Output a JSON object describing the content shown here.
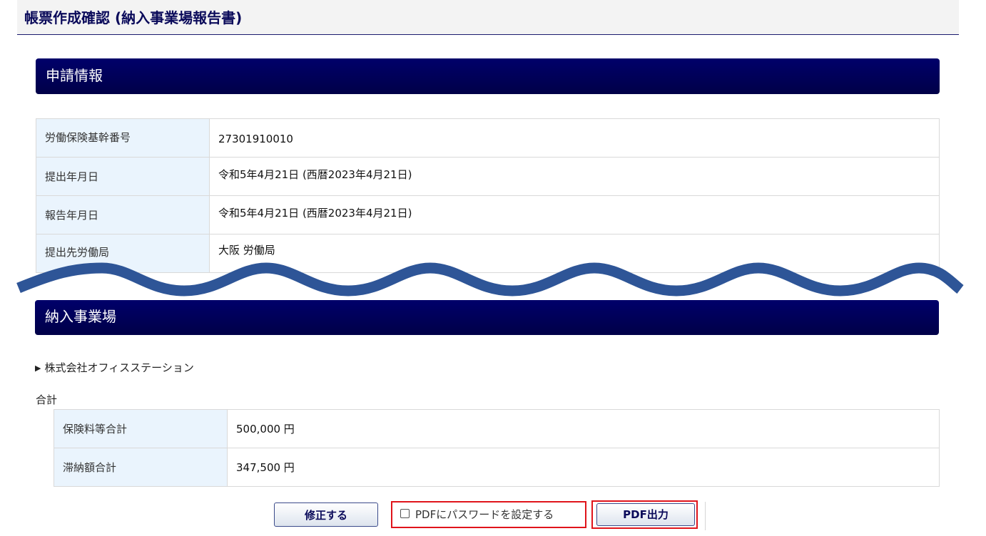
{
  "header": {
    "title": "帳票作成確認 (納入事業場報告書)"
  },
  "application_info": {
    "section_title": "申請情報",
    "rows": [
      {
        "label": "労働保険基幹番号",
        "value": "27301910010"
      },
      {
        "label": "提出年月日",
        "value": "令和5年4月21日 (西暦2023年4月21日)"
      },
      {
        "label": "報告年月日",
        "value": "令和5年4月21日 (西暦2023年4月21日)"
      },
      {
        "label": "提出先労働局",
        "value": "大阪 労働局"
      }
    ]
  },
  "delivery_sites": {
    "section_title": "納入事業場",
    "company": {
      "marker": "▶",
      "name": "株式会社オフィスステーション"
    },
    "total_label": "合計",
    "totals": [
      {
        "label": "保険料等合計",
        "value": "500,000 円"
      },
      {
        "label": "滞納額合計",
        "value": "347,500 円"
      }
    ]
  },
  "actions": {
    "edit_label": "修正する",
    "password_label": "PDFにパスワードを設定する",
    "password_checked": false,
    "pdf_label": "PDF出力"
  },
  "colors": {
    "section_bar": "#000058",
    "label_cell": "#eaf4fd",
    "highlight": "#e0141b",
    "wave": "#2e5597"
  }
}
